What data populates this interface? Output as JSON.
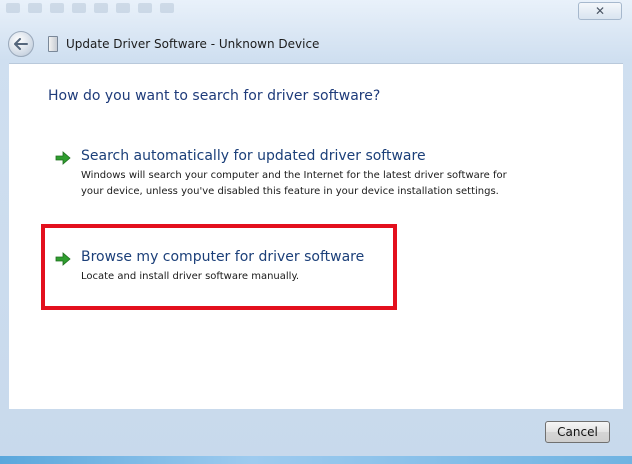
{
  "window": {
    "title": "Update Driver Software - Unknown Device",
    "close_label": "✕"
  },
  "main": {
    "heading": "How do you want to search for driver software?",
    "options": [
      {
        "title": "Search automatically for updated driver software",
        "description": "Windows will search your computer and the Internet for the latest driver software for your device, unless you've disabled this feature in your device installation settings.",
        "icon": "green-arrow-icon"
      },
      {
        "title": "Browse my computer for driver software",
        "description": "Locate and install driver software manually.",
        "icon": "green-arrow-icon",
        "highlighted": true
      }
    ]
  },
  "footer": {
    "cancel_label": "Cancel"
  },
  "colors": {
    "heading": "#1e3b7a",
    "highlight": "#e3101d",
    "arrow": "#2f9e2f"
  }
}
